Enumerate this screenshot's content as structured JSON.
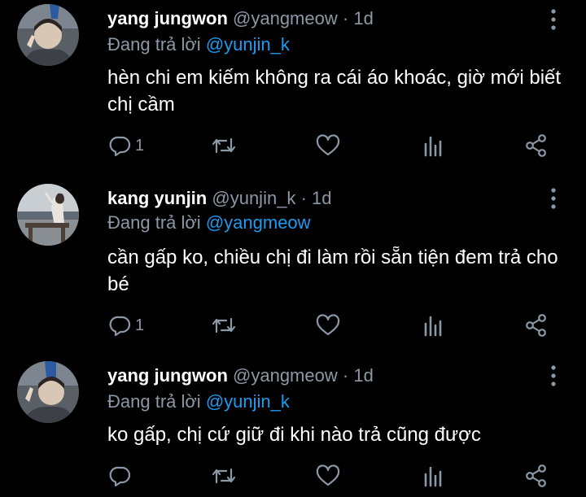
{
  "tweets": [
    {
      "name": "yang jungwon",
      "handle": "@yangmeow",
      "dot": "·",
      "time": "1d",
      "replying_prefix": "Đang trả lời",
      "replying_to": "@yunjin_k",
      "body": "hèn chi em kiếm không ra cái áo khoác, giờ mới biết chị cầm",
      "reply_count": "1"
    },
    {
      "name": "kang yunjin",
      "handle": "@yunjin_k",
      "dot": "·",
      "time": "1d",
      "replying_prefix": "Đang trả lời",
      "replying_to": "@yangmeow",
      "body": "cần gấp ko, chiều chị đi làm rồi sẵn tiện đem trả cho bé",
      "reply_count": "1"
    },
    {
      "name": "yang jungwon",
      "handle": "@yangmeow",
      "dot": "·",
      "time": "1d",
      "replying_prefix": "Đang trả lời",
      "replying_to": "@yunjin_k",
      "body": "ko gấp, chị cứ giữ đi khi nào trả cũng được",
      "reply_count": ""
    }
  ],
  "colors": {
    "background": "#000000",
    "secondary_text": "#8b98a5",
    "link": "#1d9bf0"
  },
  "icons": [
    "more-vertical-icon",
    "reply-icon",
    "retweet-icon",
    "like-icon",
    "analytics-icon",
    "share-icon"
  ]
}
